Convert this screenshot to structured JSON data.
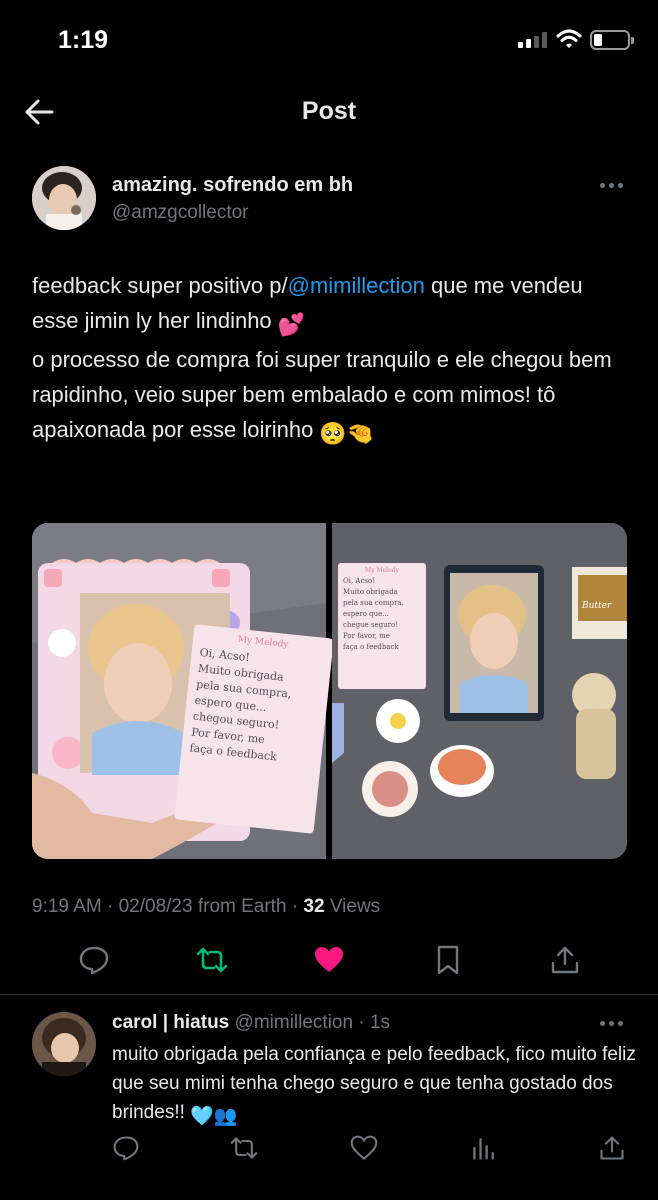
{
  "status_bar": {
    "time": "1:19"
  },
  "header": {
    "title": "Post"
  },
  "post": {
    "display_name": "amazing. sofrendo em bh",
    "handle": "@amzgcollector",
    "text_1": "feedback super positivo p/",
    "mention": "@mimillection",
    "text_2": " que me vendeu esse jimin ly her lindinho ",
    "emoji_1": "💕",
    "text_3": "o processo de compra foi super tranquilo e ele chegou bem rapidinho, veio super bem embalado e com mimos! tô apaixonada por esse loirinho ",
    "emoji_2": "🥺",
    "emoji_3": "🤏",
    "media": {
      "left_card_header": "My Melody",
      "left_card_note": [
        "Oi, Acso!",
        "Muito obrigada",
        "pela sua compra,",
        "espero que...",
        "chegou seguro!",
        "Por favor, me",
        "faça o feedback"
      ],
      "right_card_header": "My Melody",
      "right_card_note": [
        "Oi, Acso!",
        "Muito obrigada",
        "pela sua compra,",
        "espero que...",
        "chegue seguro!",
        "Por favor, me",
        "faça o feedback"
      ],
      "right_album_label": "Butter"
    },
    "timestamp": "9:19 AM · 02/08/23 from Earth · ",
    "views_count": "32",
    "views_label": " Views",
    "colors": {
      "like": "#f91880",
      "retweet": "#00ba7c",
      "mention": "#1d9bf0",
      "muted": "#71767b"
    }
  },
  "reply": {
    "display_name": "carol | hiatus",
    "meta": " @mimillection · 1s",
    "text": "muito obrigada pela confiança e pelo feedback, fico muito feliz que seu mimi tenha chego seguro e que tenha gostado dos brindes!! ",
    "emoji_1": "🩵",
    "emoji_2": "👥"
  },
  "icons": {
    "back": "arrow-left-icon",
    "reply": "comment-icon",
    "retweet": "retweet-icon",
    "like": "heart-icon",
    "bookmark": "bookmark-icon",
    "share": "share-icon",
    "views": "bar-chart-icon",
    "more": "more-dots-icon"
  }
}
